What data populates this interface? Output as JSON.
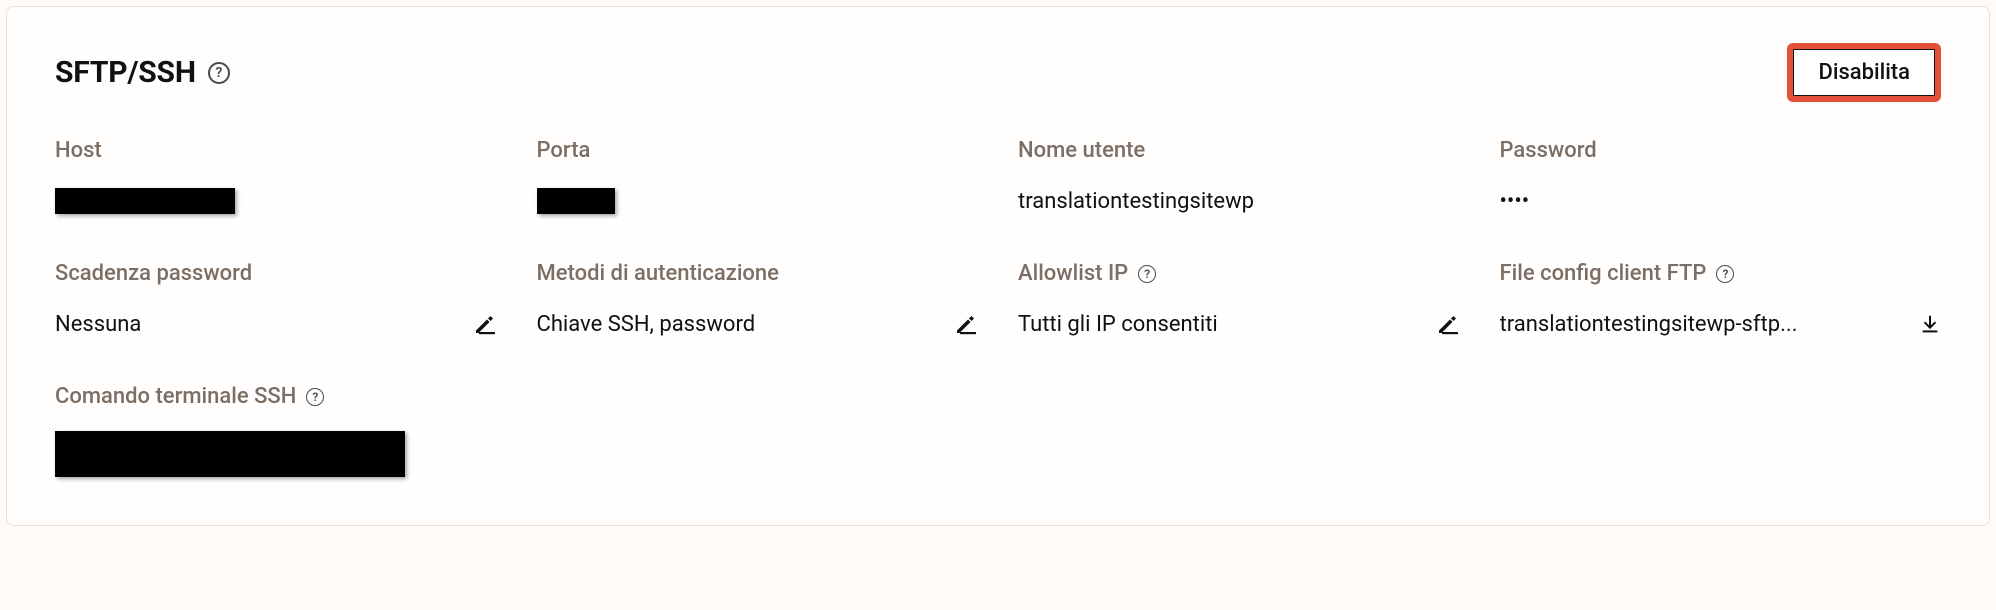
{
  "header": {
    "title": "SFTP/SSH",
    "disable_label": "Disabilita"
  },
  "fields": {
    "host": {
      "label": "Host",
      "value": ""
    },
    "port": {
      "label": "Porta",
      "value": ""
    },
    "username": {
      "label": "Nome utente",
      "value": "translationtestingsitewp"
    },
    "password": {
      "label": "Password",
      "value": "••••"
    },
    "pw_expiry": {
      "label": "Scadenza password",
      "value": "Nessuna"
    },
    "auth_methods": {
      "label": "Metodi di autenticazione",
      "value": "Chiave SSH, password"
    },
    "ip_allowlist": {
      "label": "Allowlist IP",
      "value": "Tutti gli IP consentiti"
    },
    "ftp_config": {
      "label": "File config client FTP",
      "value": "translationtestingsitewp-sftp..."
    },
    "ssh_cmd": {
      "label": "Comando terminale SSH",
      "value": ""
    }
  }
}
